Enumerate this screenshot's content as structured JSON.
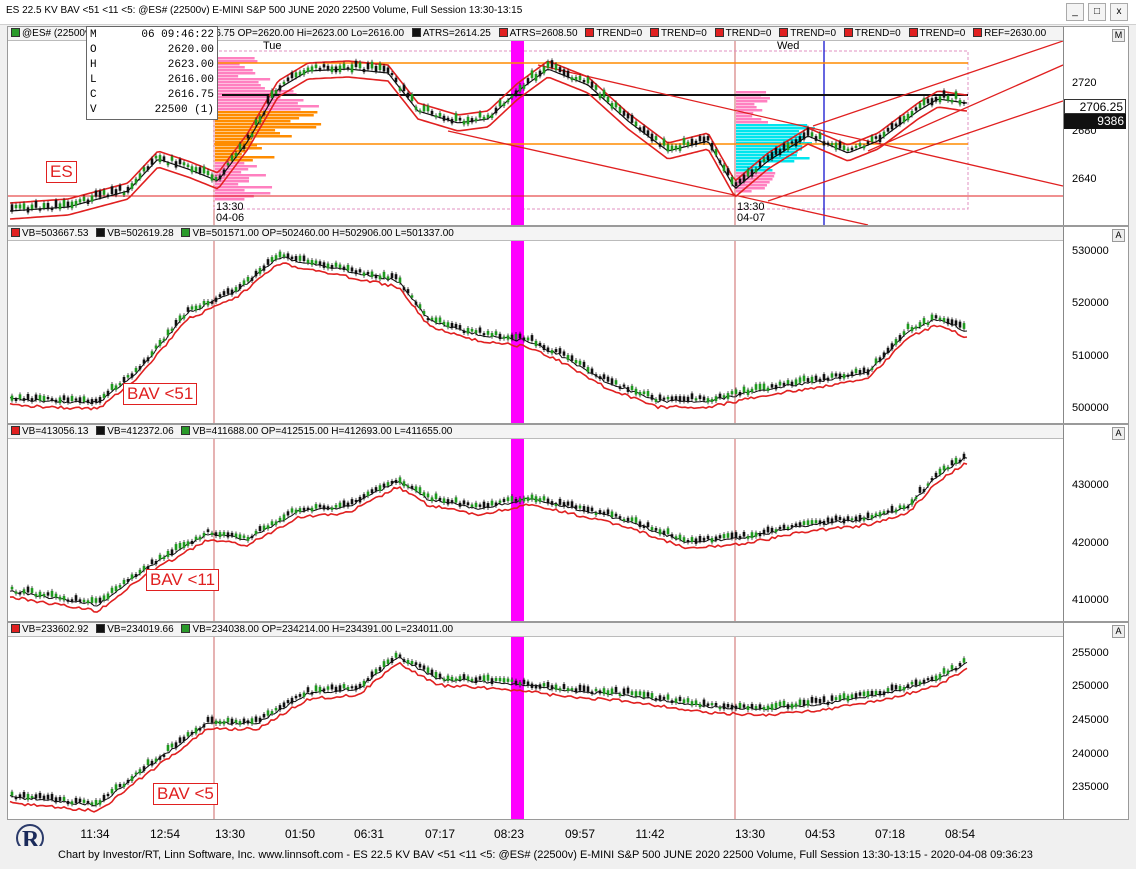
{
  "window": {
    "title": "ES 22.5 KV BAV <51 <11 <5: @ES# (22500v) E-MINI S&P 500 JUNE 2020 22500 Volume, Full Session 13:30-13:15",
    "buttons": {
      "minimize": "_",
      "maximize": "□",
      "close": "x"
    }
  },
  "price_pane": {
    "header": [
      "@ES# (22500v)-04/06/20 09:46:22 CL=2616.75 OP=2620.00 Hi=2623.00 Lo=2616.00",
      "ATRS=2614.25",
      "ATRS=2608.50",
      "TREND=0",
      "TREND=0",
      "TREND=0",
      "TREND=0",
      "TREND=0",
      "TREND=0",
      "REF=2630.00"
    ],
    "pane_button": "M",
    "label": "ES",
    "day_labels": [
      "Tue",
      "Wed"
    ],
    "session_labels": [
      {
        "time": "13:30",
        "date": "04-06"
      },
      {
        "time": "13:30",
        "date": "04-07"
      }
    ],
    "y_ticks": [
      "2720",
      "2680",
      "2640"
    ],
    "last_price": "2706.25",
    "volume_tag": "9386",
    "ohlc_box": [
      {
        "k": "M",
        "v": "06 09:46:22"
      },
      {
        "k": "O",
        "v": "2620.00"
      },
      {
        "k": "H",
        "v": "2623.00"
      },
      {
        "k": "L",
        "v": "2616.00"
      },
      {
        "k": "C",
        "v": "2616.75"
      },
      {
        "k": "V",
        "v": "22500 (1)"
      }
    ]
  },
  "bav_panes": [
    {
      "label": "BAV <51",
      "header": [
        "VB=503667.53",
        "VB=502619.28",
        "VB=501571.00 OP=502460.00 H=502906.00 L=501337.00"
      ],
      "y_ticks": [
        "530000",
        "520000",
        "510000",
        "500000"
      ],
      "pane_button": "A"
    },
    {
      "label": "BAV <11",
      "header": [
        "VB=413056.13",
        "VB=412372.06",
        "VB=411688.00 OP=412515.00 H=412693.00 L=411655.00"
      ],
      "y_ticks": [
        "430000",
        "420000",
        "410000"
      ],
      "pane_button": "A"
    },
    {
      "label": "BAV <5",
      "header": [
        "VB=233602.92",
        "VB=234019.66",
        "VB=234038.00 OP=234214.00 H=234391.00 L=234011.00"
      ],
      "y_ticks": [
        "255000",
        "250000",
        "245000",
        "240000",
        "235000"
      ],
      "pane_button": "A"
    }
  ],
  "x_axis": [
    "11:34",
    "12:54",
    "13:30",
    "01:50",
    "06:31",
    "07:17",
    "08:23",
    "09:57",
    "11:42",
    "13:30",
    "04:53",
    "07:18",
    "08:54"
  ],
  "footer": "Chart by Investor/RT, Linn Software, Inc. www.linnsoft.com - ES 22.5 KV BAV <51 <11 <5: @ES# (22500v) E-MINI S&P 500 JUNE 2020 22500 Volume, Full Session 13:30-13:15 - 2020-04-08 09:36:23",
  "colors": {
    "highlight": "#ff00ff",
    "bands": "#e02020",
    "profile_orange": "#ff8c00",
    "profile_pink": "#ff80c0",
    "profile_cyan": "#00e5ee",
    "cursor_line": "#0000cc"
  }
}
